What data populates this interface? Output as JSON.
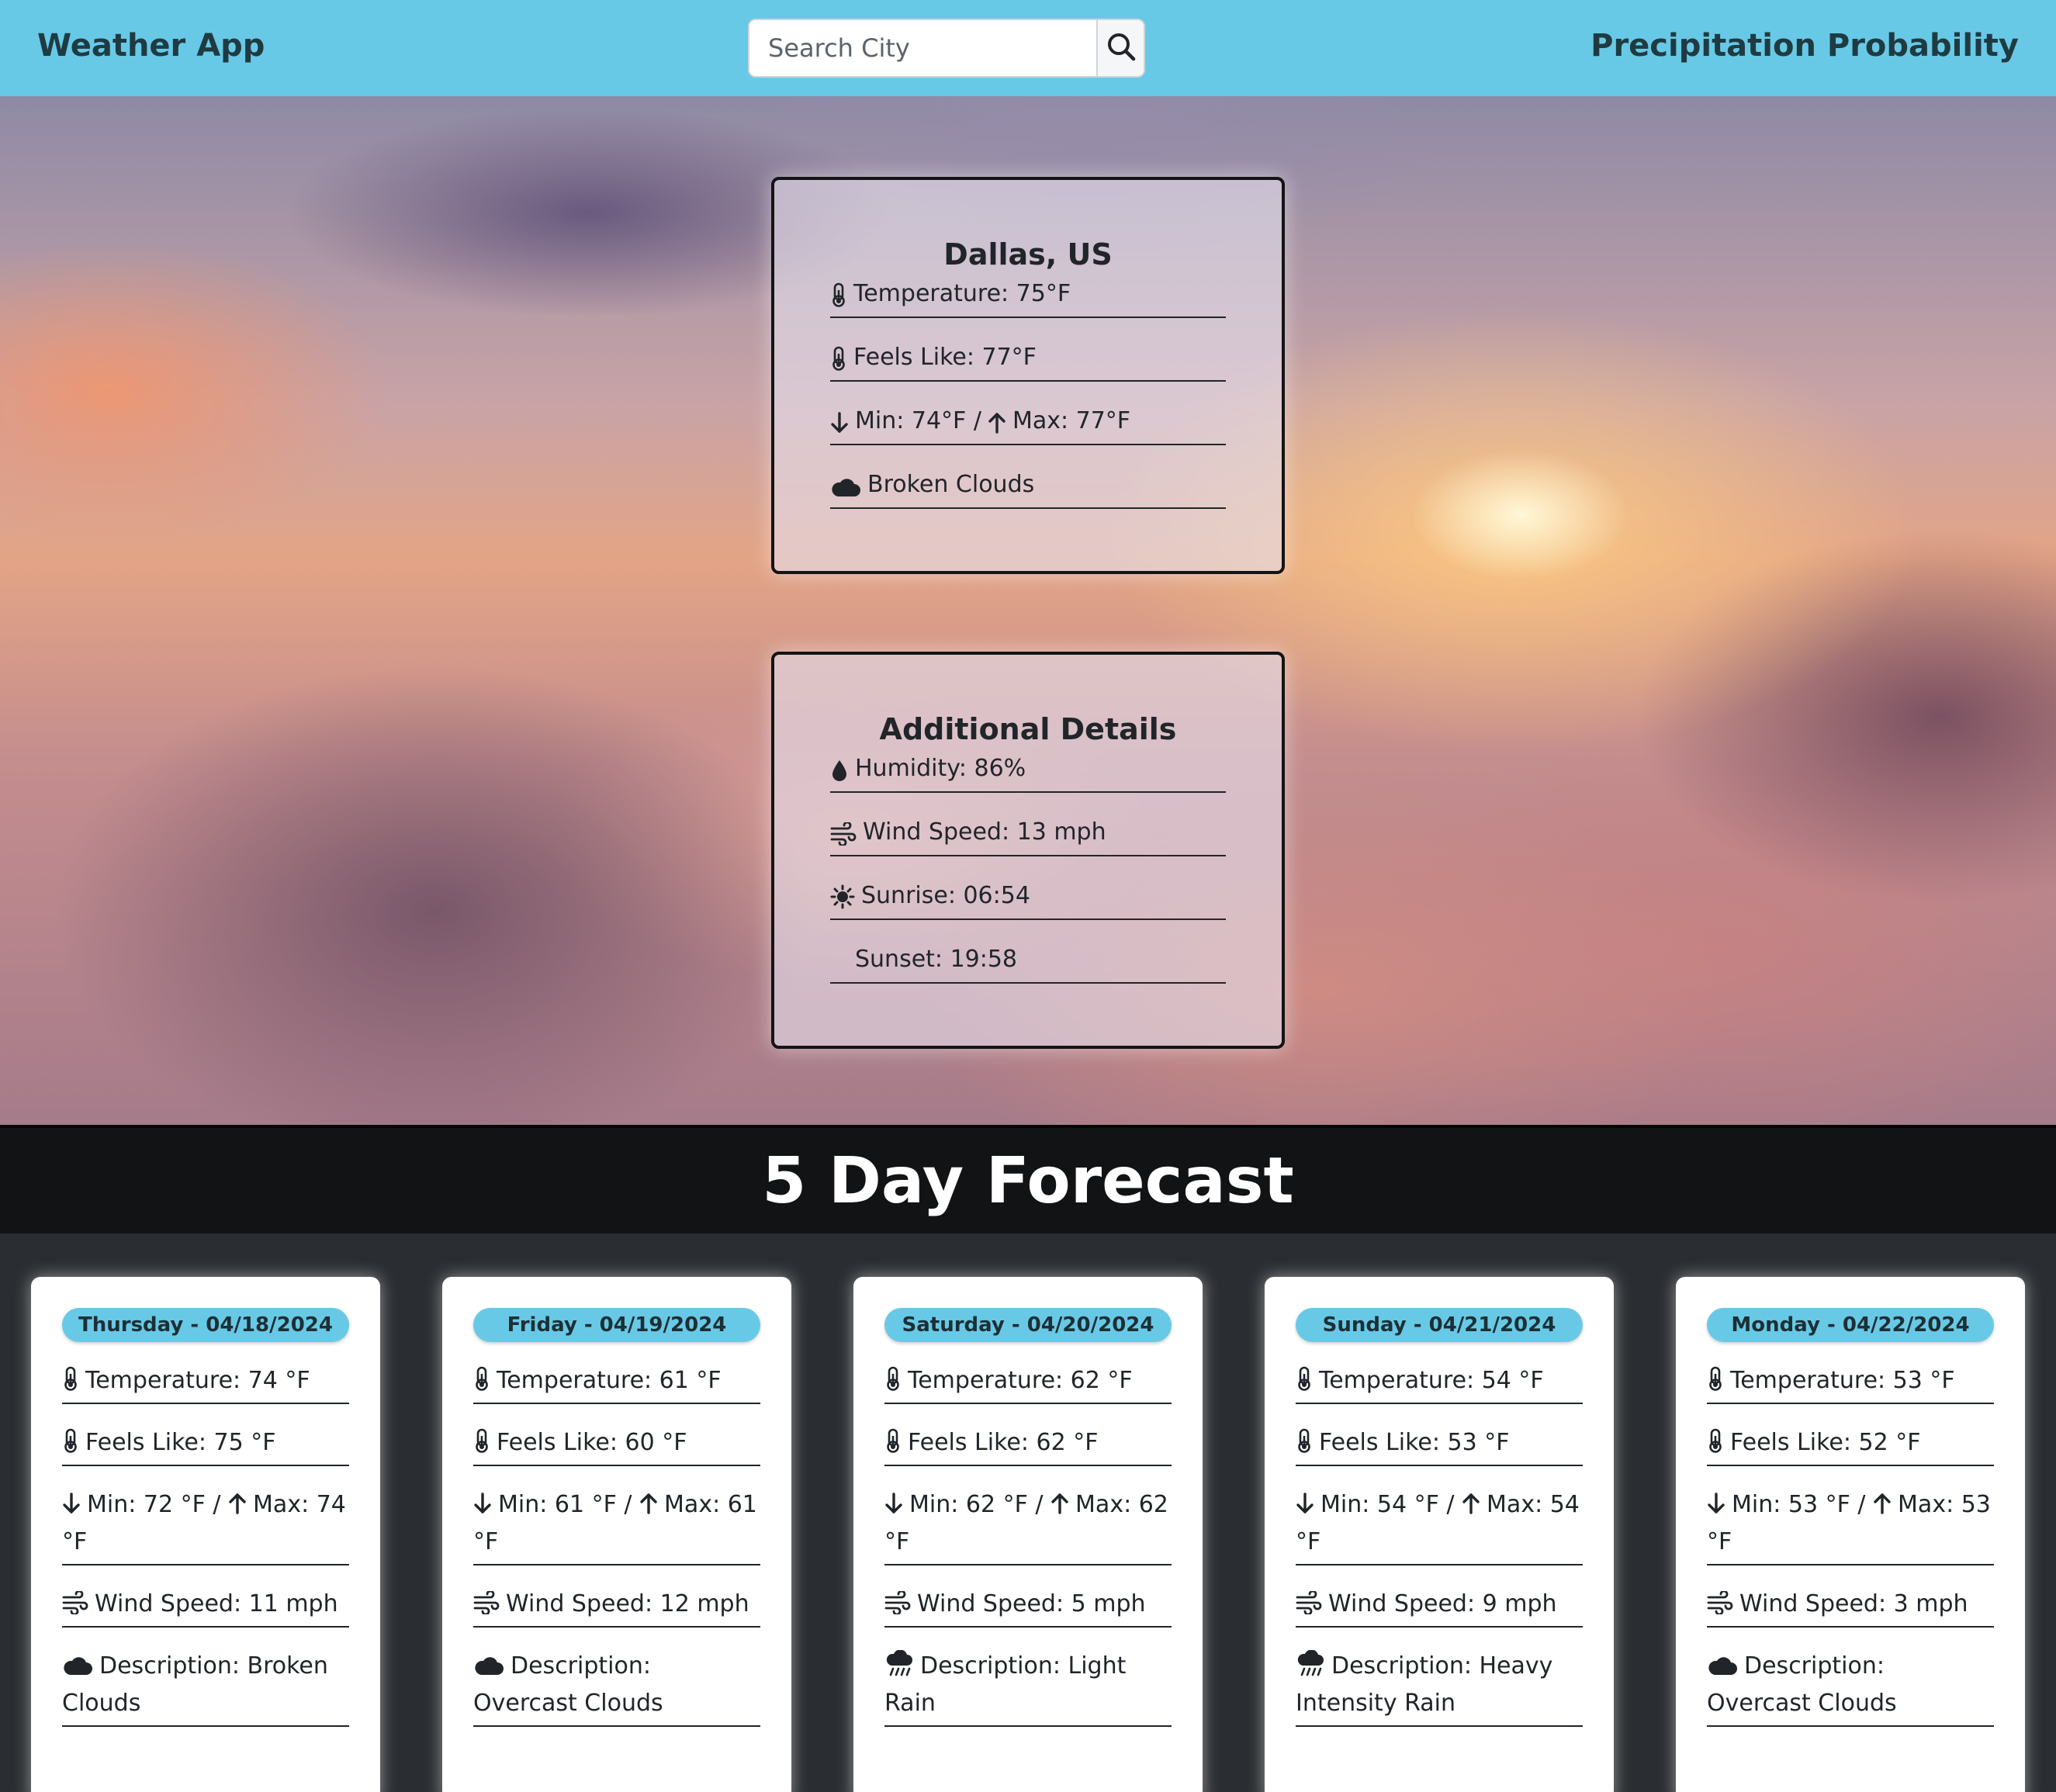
{
  "header": {
    "brand": "Weather App",
    "search_placeholder": "Search City",
    "nav_right": "Precipitation Probability"
  },
  "current": {
    "city": "Dallas, US",
    "temperature": "Temperature: 75°F",
    "feels_like": "Feels Like: 77°F",
    "min_text": "Min: 74°F /",
    "max_text": "Max: 77°F",
    "description": "Broken Clouds"
  },
  "details": {
    "title": "Additional Details",
    "humidity": "Humidity: 86%",
    "wind": "Wind Speed: 13 mph",
    "sunrise": "Sunrise: 06:54",
    "sunset": "Sunset: 19:58"
  },
  "forecast": {
    "title": "5 Day Forecast",
    "days": [
      {
        "date": "Thursday - 04/18/2024",
        "temperature": "Temperature: 74 °F",
        "feels_like": "Feels Like: 75 °F",
        "min_text": "Min: 72 °F /",
        "max_text": "Max: 74 °F",
        "wind": "Wind Speed: 11 mph",
        "description": "Description: Broken Clouds",
        "icon": "cloud-icon"
      },
      {
        "date": "Friday - 04/19/2024",
        "temperature": "Temperature: 61 °F",
        "feels_like": "Feels Like: 60 °F",
        "min_text": "Min: 61 °F /",
        "max_text": "Max: 61 °F",
        "wind": "Wind Speed: 12 mph",
        "description": "Description: Overcast Clouds",
        "icon": "cloud-icon"
      },
      {
        "date": "Saturday - 04/20/2024",
        "temperature": "Temperature: 62 °F",
        "feels_like": "Feels Like: 62 °F",
        "min_text": "Min: 62 °F /",
        "max_text": "Max: 62 °F",
        "wind": "Wind Speed: 5 mph",
        "description": "Description: Light Rain",
        "icon": "rain-icon"
      },
      {
        "date": "Sunday - 04/21/2024",
        "temperature": "Temperature: 54 °F",
        "feels_like": "Feels Like: 53 °F",
        "min_text": "Min: 54 °F /",
        "max_text": "Max: 54 °F",
        "wind": "Wind Speed: 9 mph",
        "description": "Description: Heavy Intensity Rain",
        "icon": "rain-icon"
      },
      {
        "date": "Monday - 04/22/2024",
        "temperature": "Temperature: 53 °F",
        "feels_like": "Feels Like: 52 °F",
        "min_text": "Min: 53 °F /",
        "max_text": "Max: 53 °F",
        "wind": "Wind Speed: 3 mph",
        "description": "Description: Overcast Clouds",
        "icon": "cloud-icon"
      }
    ]
  },
  "colors": {
    "accent": "#68c9e6",
    "dark_band": "#121315",
    "page_bg": "#2a2d31"
  }
}
